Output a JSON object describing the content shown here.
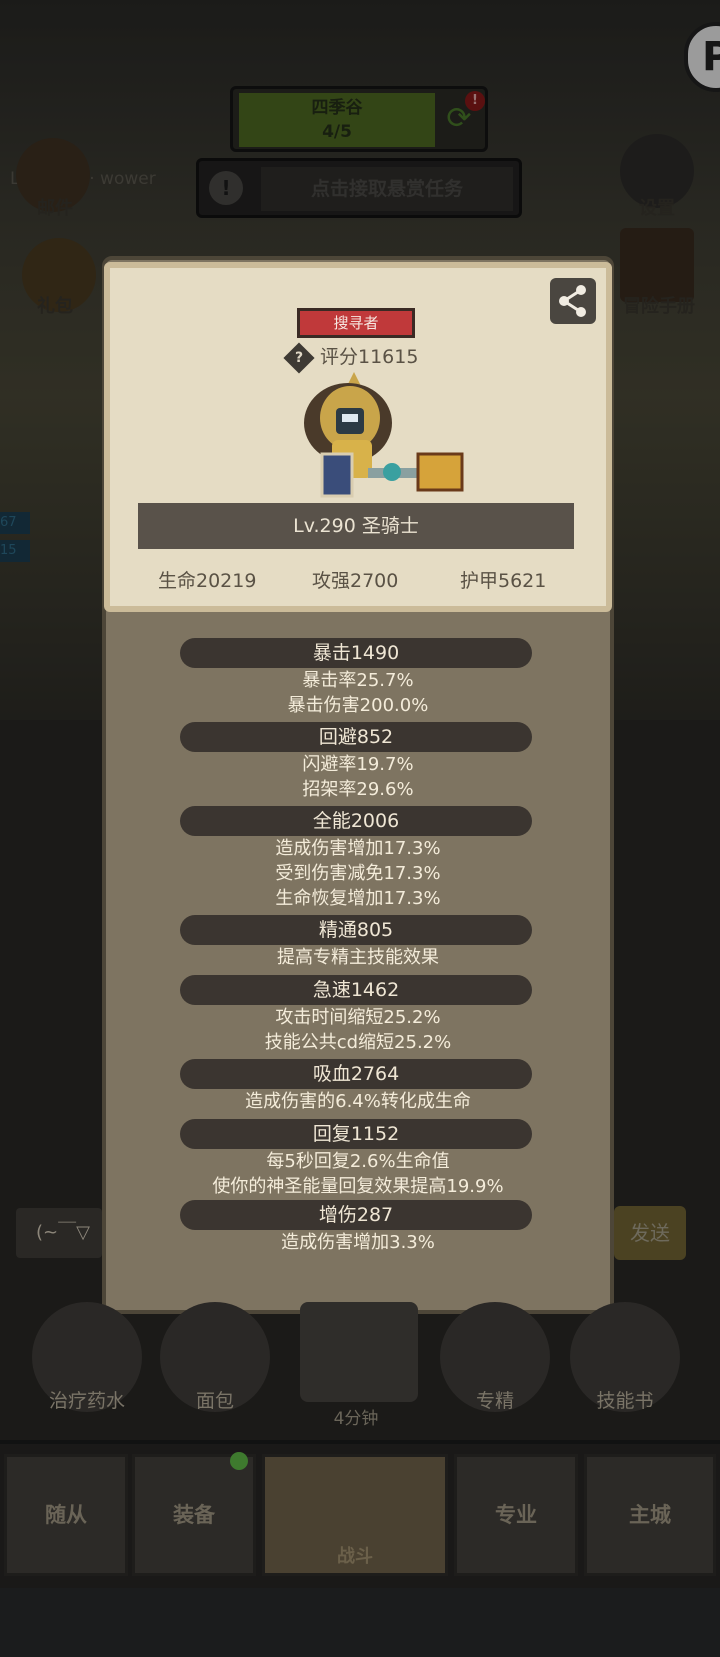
{
  "stage": {
    "name": "四季谷",
    "progress": "4/5",
    "alert": "!"
  },
  "bounty": {
    "text": "点击接取悬赏任务",
    "icon": "!"
  },
  "player": {
    "label": "Lv.4 战士 · wower"
  },
  "hud": {
    "left_labels": [
      "邮件",
      "礼包"
    ],
    "right_labels": [
      "设置",
      "冒险手册"
    ],
    "left_tags": [
      "67",
      "15"
    ]
  },
  "card": {
    "rank": "搜寻者",
    "score_label": "评分11615",
    "score_icon": "?",
    "name": "Lv.290 圣骑士",
    "base_stats": [
      "生命20219",
      "攻强2700",
      "护甲5621"
    ]
  },
  "stats": [
    {
      "header": "暴击1490",
      "lines": [
        "暴击率25.7%",
        "暴击伤害200.0%"
      ]
    },
    {
      "header": "回避852",
      "lines": [
        "闪避率19.7%",
        "招架率29.6%"
      ]
    },
    {
      "header": "全能2006",
      "lines": [
        "造成伤害增加17.3%",
        "受到伤害减免17.3%",
        "生命恢复增加17.3%"
      ]
    },
    {
      "header": "精通805",
      "lines": [
        "提高专精主技能效果"
      ]
    },
    {
      "header": "急速1462",
      "lines": [
        "攻击时间缩短25.2%",
        "技能公共cd缩短25.2%"
      ]
    },
    {
      "header": "吸血2764",
      "lines": [
        "造成伤害的6.4%转化成生命"
      ]
    },
    {
      "header": "回复1152",
      "lines": [
        "每5秒回复2.6%生命值",
        "使你的神圣能量回复效果提高19.9%"
      ]
    },
    {
      "header": "增伤287",
      "lines": [
        "造成伤害增加3.3%"
      ]
    }
  ],
  "chat": {
    "placeholder": "(~￣▽",
    "send": "发送"
  },
  "quick_items": [
    "治疗药水",
    "面包",
    "专精",
    "技能书"
  ],
  "timer": "4分钟",
  "nav": [
    "随从",
    "装备",
    "战斗",
    "专业",
    "主城"
  ],
  "colors": {
    "panel": "#7e7461",
    "card": "#e5dcc4",
    "rank_badge": "#c0393a",
    "stat_header": "#3b3530"
  }
}
